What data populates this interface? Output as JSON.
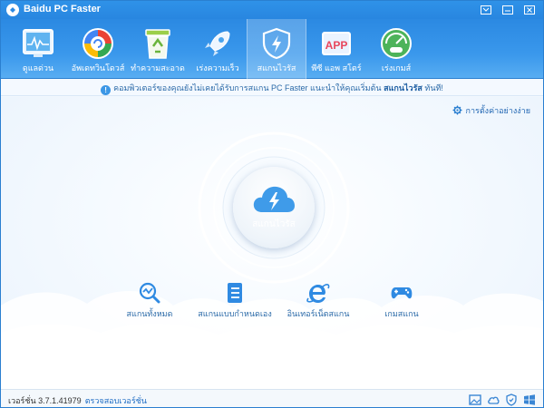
{
  "window": {
    "title": "Baidu PC Faster",
    "accent": "#2b89e2"
  },
  "toolbar": {
    "items": [
      {
        "label": "ดูแลด่วน",
        "icon": "monitor-icon"
      },
      {
        "label": "อัพเดทวินโดวส์",
        "icon": "update-icon"
      },
      {
        "label": "ทำความสะอาด",
        "icon": "recycle-bin-icon"
      },
      {
        "label": "เร่งความเร็ว",
        "icon": "rocket-icon"
      },
      {
        "label": "สแกนไวรัส",
        "icon": "shield-icon",
        "active": true
      },
      {
        "label": "พีซี แอพ สโตร์",
        "icon": "app-store-icon"
      },
      {
        "label": "เร่งเกมส์",
        "icon": "game-speed-icon"
      }
    ]
  },
  "notice": {
    "text": "คอมพิวเตอร์ของคุณยังไม่เคยได้รับการสแกน PC Faster แนะนำให้คุณเริ่มต้น",
    "link": "สแกนไวรัส",
    "suffix": " ทันที!"
  },
  "main": {
    "settings_label": "การตั้งค่าอย่างง่าย",
    "scan_button_label": "สแกนไวรัส",
    "actions": [
      {
        "label": "สแกนทั้งหมด",
        "icon": "chart-search-icon"
      },
      {
        "label": "สแกนแบบกำหนดเอง",
        "icon": "list-icon"
      },
      {
        "label": "อินเทอร์เน็ตสแกน",
        "icon": "internet-explorer-icon"
      },
      {
        "label": "เกมสแกน",
        "icon": "gamepad-icon"
      }
    ]
  },
  "status": {
    "version_label": "เวอร์ชั่น 3.7.1.41979",
    "check_version": "ตรวจสอบเวอร์ชั่น"
  }
}
